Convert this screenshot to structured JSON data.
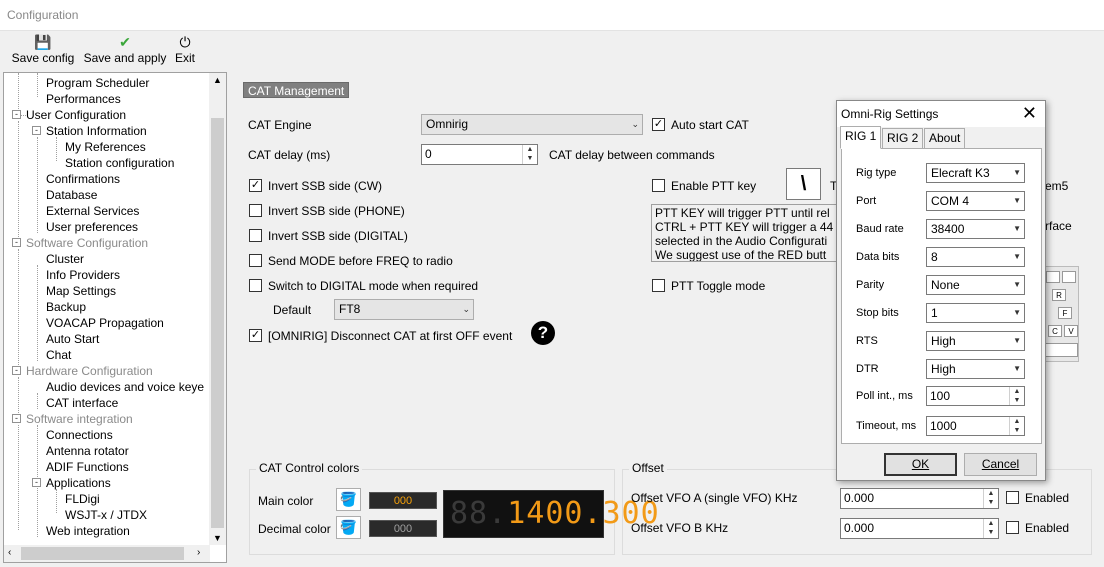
{
  "window": {
    "title": "Configuration"
  },
  "toolbar": {
    "save_config": "Save config",
    "save_apply": "Save and apply",
    "exit": "Exit"
  },
  "tree": [
    {
      "label": "Program Scheduler",
      "gray": false
    },
    {
      "label": "Performances",
      "gray": false
    },
    {
      "label": "User Configuration",
      "gray": false
    },
    {
      "label": "Station Information",
      "gray": false
    },
    {
      "label": "My References",
      "gray": false
    },
    {
      "label": "Station configuration",
      "gray": false
    },
    {
      "label": "Confirmations",
      "gray": false
    },
    {
      "label": "Database",
      "gray": false
    },
    {
      "label": "External Services",
      "gray": false
    },
    {
      "label": "User preferences",
      "gray": false
    },
    {
      "label": "Software Configuration",
      "gray": true
    },
    {
      "label": "Cluster",
      "gray": false
    },
    {
      "label": "Info Providers",
      "gray": false
    },
    {
      "label": "Map Settings",
      "gray": false
    },
    {
      "label": "Backup",
      "gray": false
    },
    {
      "label": "VOACAP Propagation",
      "gray": false
    },
    {
      "label": "Auto Start",
      "gray": false
    },
    {
      "label": "Chat",
      "gray": false
    },
    {
      "label": "Hardware Configuration",
      "gray": true
    },
    {
      "label": "Audio devices and voice keye",
      "gray": false
    },
    {
      "label": "CAT interface",
      "gray": false
    },
    {
      "label": "Software integration",
      "gray": true
    },
    {
      "label": "Connections",
      "gray": false
    },
    {
      "label": "Antenna rotator",
      "gray": false
    },
    {
      "label": "ADIF Functions",
      "gray": false
    },
    {
      "label": "Applications",
      "gray": false
    },
    {
      "label": "FLDigi",
      "gray": false
    },
    {
      "label": "WSJT-x / JTDX",
      "gray": false
    },
    {
      "label": "Web integration",
      "gray": false
    }
  ],
  "cat": {
    "section_title": "CAT Management",
    "engine_label": "CAT Engine",
    "engine_value": "Omnirig",
    "auto_start": "Auto start CAT",
    "delay_label": "CAT delay (ms)",
    "delay_value": "0",
    "delay_desc": "CAT delay between commands",
    "invert_cw": "Invert SSB side (CW)",
    "invert_phone": "Invert SSB side (PHONE)",
    "invert_digital": "Invert SSB side (DIGITAL)",
    "send_mode": "Send MODE before FREQ to radio",
    "switch_digital": "Switch to DIGITAL mode when required",
    "default_label": "Default",
    "default_value": "FT8",
    "omnirig_disconnect": "[OMNIRIG] Disconnect CAT at first OFF event",
    "enable_ptt": "Enable PTT key",
    "ptt_key": "\\",
    "ptt_t": "T",
    "ptt_info": [
      "PTT KEY will trigger PTT until rel",
      "CTRL + PTT KEY will trigger a 44",
      "selected in the Audio Configurati",
      "We suggest use of the RED butt"
    ],
    "ptt_toggle": "PTT Toggle mode",
    "behind_item5": "em5",
    "behind_rface": "rface",
    "behind_keys": [
      "R",
      "F",
      "C",
      "V"
    ]
  },
  "colors": {
    "group_title": "CAT Control colors",
    "main_label": "Main color",
    "main_value": "000",
    "decimal_label": "Decimal color",
    "decimal_value": "000",
    "display_dim": "88.",
    "display_on1": "14",
    "display_on2": "00",
    "display_dot": ".",
    "display_on3": "300",
    "main_accent": "#f29a17"
  },
  "offset": {
    "group_title": "Offset",
    "vfo_a_label": "Offset VFO A (single VFO) KHz",
    "vfo_a_value": "0.000",
    "vfo_a_enabled": "Enabled",
    "vfo_b_label": "Offset VFO B KHz",
    "vfo_b_value": "0.000",
    "vfo_b_enabled": "Enabled"
  },
  "dialog": {
    "title": "Omni-Rig Settings",
    "tabs": [
      "RIG 1",
      "RIG 2",
      "About"
    ],
    "fields": [
      {
        "label": "Rig type",
        "value": "Elecraft K3",
        "kind": "combo"
      },
      {
        "label": "Port",
        "value": "COM 4",
        "kind": "combo"
      },
      {
        "label": "Baud rate",
        "value": "38400",
        "kind": "combo"
      },
      {
        "label": "Data bits",
        "value": "8",
        "kind": "combo"
      },
      {
        "label": "Parity",
        "value": "None",
        "kind": "combo"
      },
      {
        "label": "Stop bits",
        "value": "1",
        "kind": "combo"
      },
      {
        "label": "RTS",
        "value": "High",
        "kind": "combo"
      },
      {
        "label": "DTR",
        "value": "High",
        "kind": "combo"
      },
      {
        "label": "Poll int., ms",
        "value": "100",
        "kind": "spin"
      },
      {
        "label": "Timeout, ms",
        "value": "1000",
        "kind": "spin"
      }
    ],
    "ok": "OK",
    "cancel": "Cancel"
  }
}
